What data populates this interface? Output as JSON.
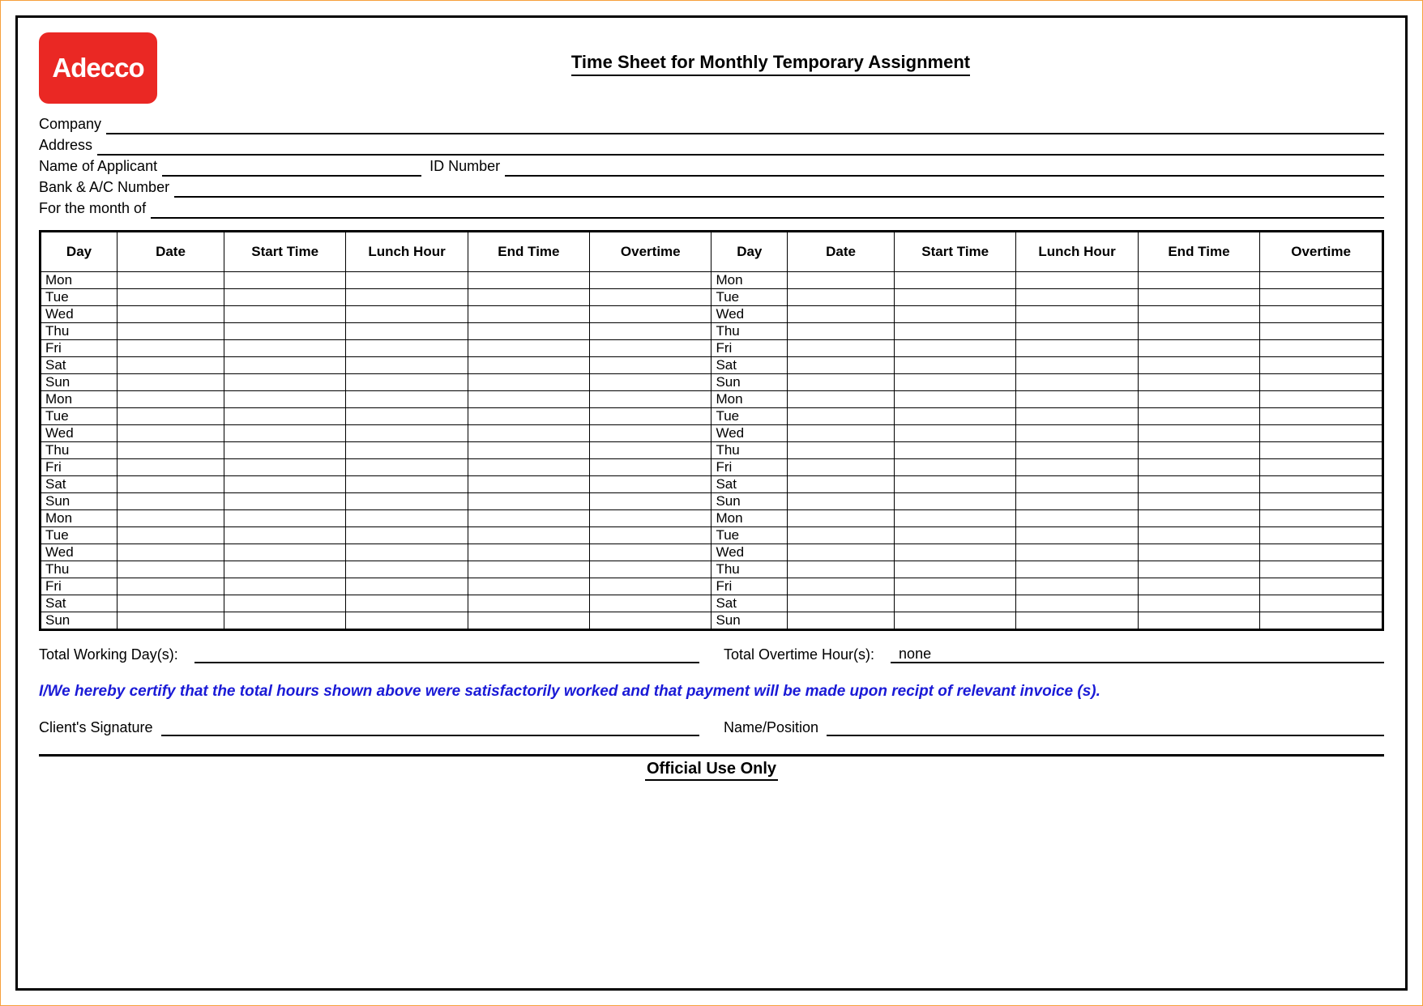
{
  "logo_text": "Adecco",
  "title": "Time Sheet for Monthly Temporary Assignment",
  "fields": {
    "company": "Company",
    "address": "Address",
    "applicant": "Name of Applicant",
    "id_number": "ID Number",
    "bank": "Bank & A/C Number",
    "month": "For the month of"
  },
  "columns": {
    "day": "Day",
    "date": "Date",
    "start": "Start Time",
    "lunch": "Lunch Hour",
    "end": "End Time",
    "overtime": "Overtime"
  },
  "days": [
    "Mon",
    "Tue",
    "Wed",
    "Thu",
    "Fri",
    "Sat",
    "Sun",
    "Mon",
    "Tue",
    "Wed",
    "Thu",
    "Fri",
    "Sat",
    "Sun",
    "Mon",
    "Tue",
    "Wed",
    "Thu",
    "Fri",
    "Sat",
    "Sun"
  ],
  "totals": {
    "working_days_label": "Total Working Day(s):",
    "working_days_value": "",
    "overtime_label": "Total Overtime Hour(s):",
    "overtime_value": "none"
  },
  "certification": "I/We hereby certify that the total hours shown above were satisfactorily worked and that payment will be made upon recipt of relevant invoice (s).",
  "signature": {
    "client": "Client's Signature",
    "name_position": "Name/Position"
  },
  "official": "Official Use Only"
}
